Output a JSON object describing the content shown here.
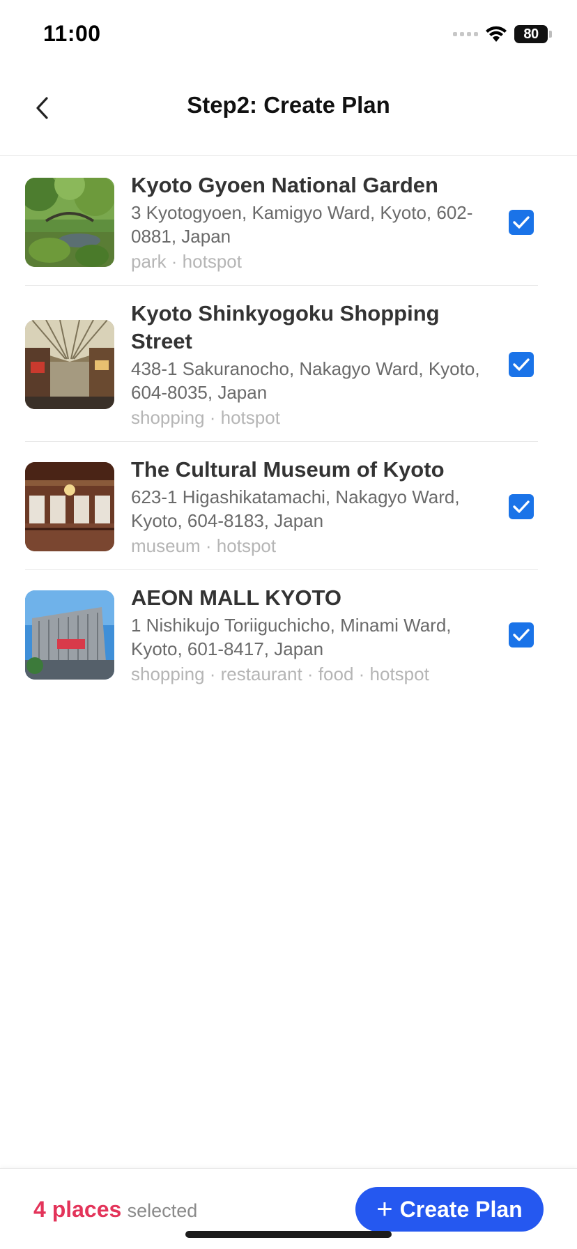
{
  "status_bar": {
    "time": "11:00",
    "battery": "80"
  },
  "header": {
    "title": "Step2: Create Plan",
    "back_icon": "chevron-left-icon"
  },
  "places": [
    {
      "name": "Kyoto Gyoen National Garden",
      "address": "3 Kyotogyoen, Kamigyo Ward, Kyoto, 602-0881, Japan",
      "tags": "park · hotspot",
      "checked": true
    },
    {
      "name": "Kyoto Shinkyogoku Shopping Street",
      "address": "438-1 Sakuranocho, Nakagyo Ward, Kyoto, 604-8035, Japan",
      "tags": "shopping · hotspot",
      "checked": true
    },
    {
      "name": "The Cultural Museum of Kyoto",
      "address": "623-1 Higashikatamachi, Nakagyo Ward, Kyoto, 604-8183, Japan",
      "tags": "museum · hotspot",
      "checked": true
    },
    {
      "name": "AEON MALL KYOTO",
      "address": "1 Nishikujo Toriiguchicho, Minami Ward, Kyoto, 601-8417, Japan",
      "tags": "shopping · restaurant · food · hotspot",
      "checked": true
    }
  ],
  "footer": {
    "count_label": "4 places",
    "suffix_label": "selected",
    "create_button_label": "Create Plan"
  },
  "colors": {
    "accent_blue": "#2558f0",
    "checkbox_blue": "#1a73e8",
    "count_red": "#e3345a"
  }
}
